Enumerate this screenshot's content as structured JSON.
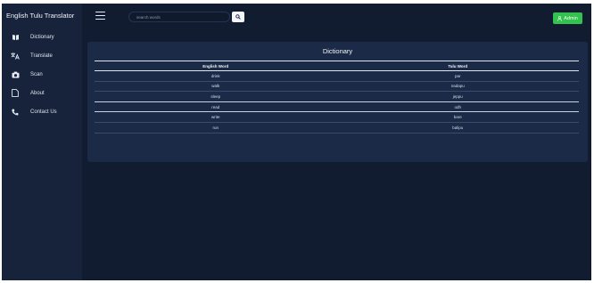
{
  "sidebar": {
    "brand": "English Tulu Translator",
    "items": [
      {
        "label": "Dictionary",
        "icon": "book-icon"
      },
      {
        "label": "Translate",
        "icon": "translate-icon"
      },
      {
        "label": "Scan",
        "icon": "camera-icon"
      },
      {
        "label": "About",
        "icon": "file-icon"
      },
      {
        "label": "Contact Us",
        "icon": "phone-icon"
      }
    ]
  },
  "topbar": {
    "menu_icon": "hamburger-icon",
    "search": {
      "placeholder": "search words",
      "value": ""
    },
    "search_icon": "search-icon",
    "admin_label": "Admin",
    "admin_icon": "user-icon",
    "admin_color": "#33c24d"
  },
  "dictionary": {
    "title": "Dictionary",
    "columns": [
      "English Word",
      "Tulu Word"
    ],
    "rows": [
      [
        "drink",
        "par"
      ],
      [
        "walk",
        "nadapu"
      ],
      [
        "sleep",
        "jeppu"
      ],
      [
        "read",
        "odh"
      ],
      [
        "write",
        "bare"
      ],
      [
        "run",
        "balipu"
      ]
    ]
  }
}
